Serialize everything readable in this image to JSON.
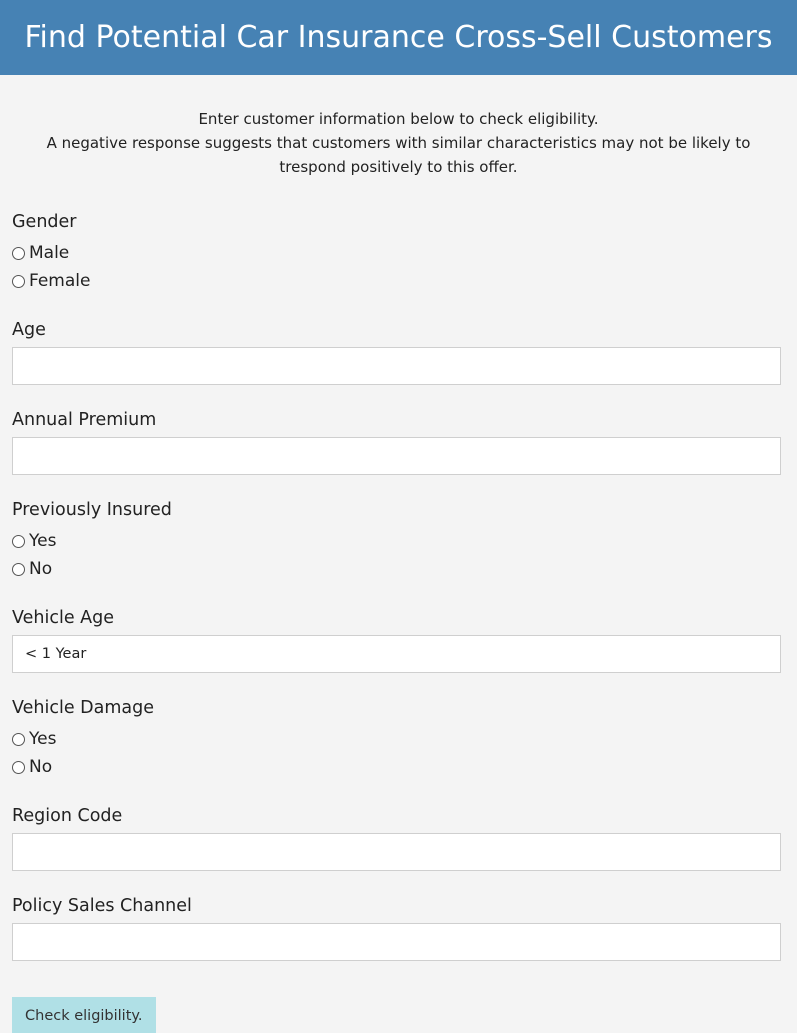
{
  "header": {
    "title": "Find Potential Car Insurance Cross-Sell Customers"
  },
  "intro": {
    "line1": "Enter customer information below to check eligibility.",
    "line2": "A negative response suggests that customers with similar characteristics may not be likely to trespond positively to this offer."
  },
  "form": {
    "gender": {
      "label": "Gender",
      "options": [
        "Male",
        "Female"
      ]
    },
    "age": {
      "label": "Age",
      "value": ""
    },
    "annual_premium": {
      "label": "Annual Premium",
      "value": ""
    },
    "previously_insured": {
      "label": "Previously Insured",
      "options": [
        "Yes",
        "No"
      ]
    },
    "vehicle_age": {
      "label": "Vehicle Age",
      "selected": "< 1 Year"
    },
    "vehicle_damage": {
      "label": "Vehicle Damage",
      "options": [
        "Yes",
        "No"
      ]
    },
    "region_code": {
      "label": "Region Code",
      "value": ""
    },
    "policy_sales_channel": {
      "label": "Policy Sales Channel",
      "value": ""
    },
    "submit_label": "Check eligibility."
  }
}
